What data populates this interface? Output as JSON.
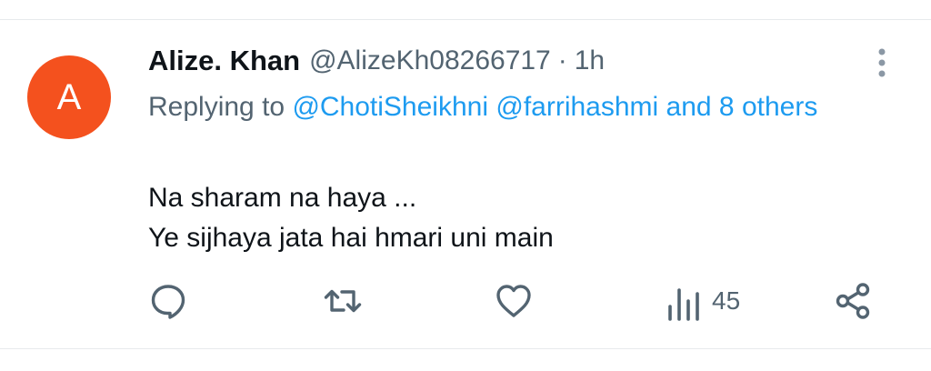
{
  "author": {
    "avatar_letter": "A",
    "avatar_color": "#f4511e",
    "display_name": "Alize. Khan",
    "handle": "@AlizeKh08266717",
    "separator": "·",
    "time": "1h"
  },
  "reply": {
    "prefix": "Replying to",
    "mentions": [
      "@ChotiSheikhni",
      "@farrihashmi"
    ],
    "others": "and 8 others"
  },
  "body": {
    "lines": [
      "Na sharam na haya ...",
      "Ye sijhaya jata hai hmari uni main"
    ]
  },
  "actions": {
    "reply_icon": "reply-icon",
    "retweet_icon": "retweet-icon",
    "like_icon": "heart-icon",
    "views_icon": "views-icon",
    "views_count": "45",
    "share_icon": "share-icon"
  },
  "colors": {
    "text": "#0f1419",
    "muted": "#536471",
    "link": "#1d9bf0",
    "divider": "#e7eaec"
  }
}
